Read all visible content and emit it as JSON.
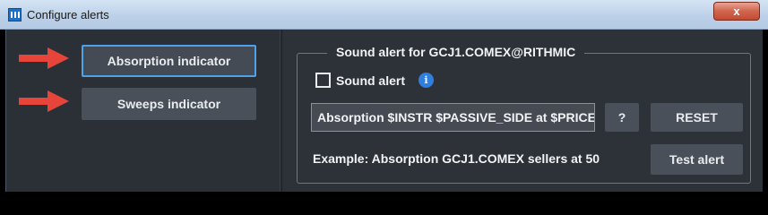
{
  "window": {
    "title": "Configure alerts",
    "close_label": "x"
  },
  "left": {
    "absorption_label": "Absorption indicator",
    "sweeps_label": "Sweeps indicator"
  },
  "sound": {
    "group_title": "Sound alert for GCJ1.COMEX@RITHMIC",
    "checkbox_label": "Sound alert",
    "checkbox_checked": false,
    "info_glyph": "i",
    "template_value": "Absorption $INSTR $PASSIVE_SIDE at $PRICE",
    "help_label": "?",
    "reset_label": "RESET",
    "example_text": "Example: Absorption GCJ1.COMEX sellers at 50",
    "test_label": "Test alert"
  },
  "colors": {
    "accent_border": "#4ea3e8",
    "arrow": "#e8453a",
    "info": "#2f7fe0"
  }
}
